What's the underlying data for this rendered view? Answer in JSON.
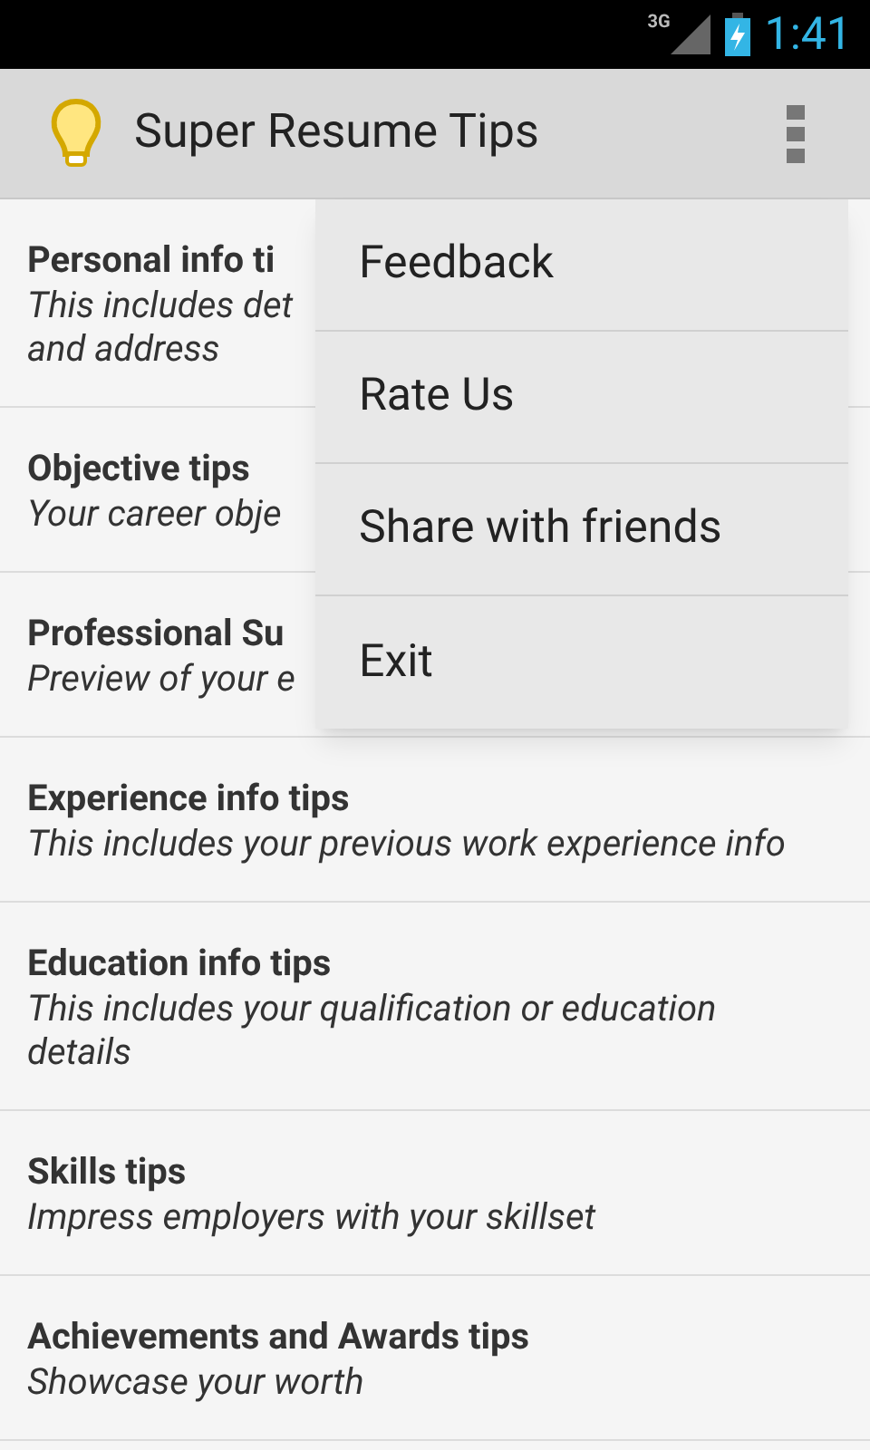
{
  "status_bar": {
    "network": "3G",
    "time": "1:41"
  },
  "action_bar": {
    "title": "Super Resume Tips"
  },
  "list": [
    {
      "title": "Personal info ti",
      "subtitle": "This includes det\nand address"
    },
    {
      "title": "Objective tips",
      "subtitle": "Your career obje"
    },
    {
      "title": "Professional Su",
      "subtitle": "Preview of your e"
    },
    {
      "title": "Experience info tips",
      "subtitle": "This includes your previous work experience info"
    },
    {
      "title": "Education info tips",
      "subtitle": "This includes your qualification or education details"
    },
    {
      "title": "Skills tips",
      "subtitle": "Impress employers with your skillset"
    },
    {
      "title": "Achievements and Awards tips",
      "subtitle": "Showcase your worth"
    }
  ],
  "menu": [
    "Feedback",
    "Rate Us",
    "Share with friends",
    "Exit"
  ]
}
